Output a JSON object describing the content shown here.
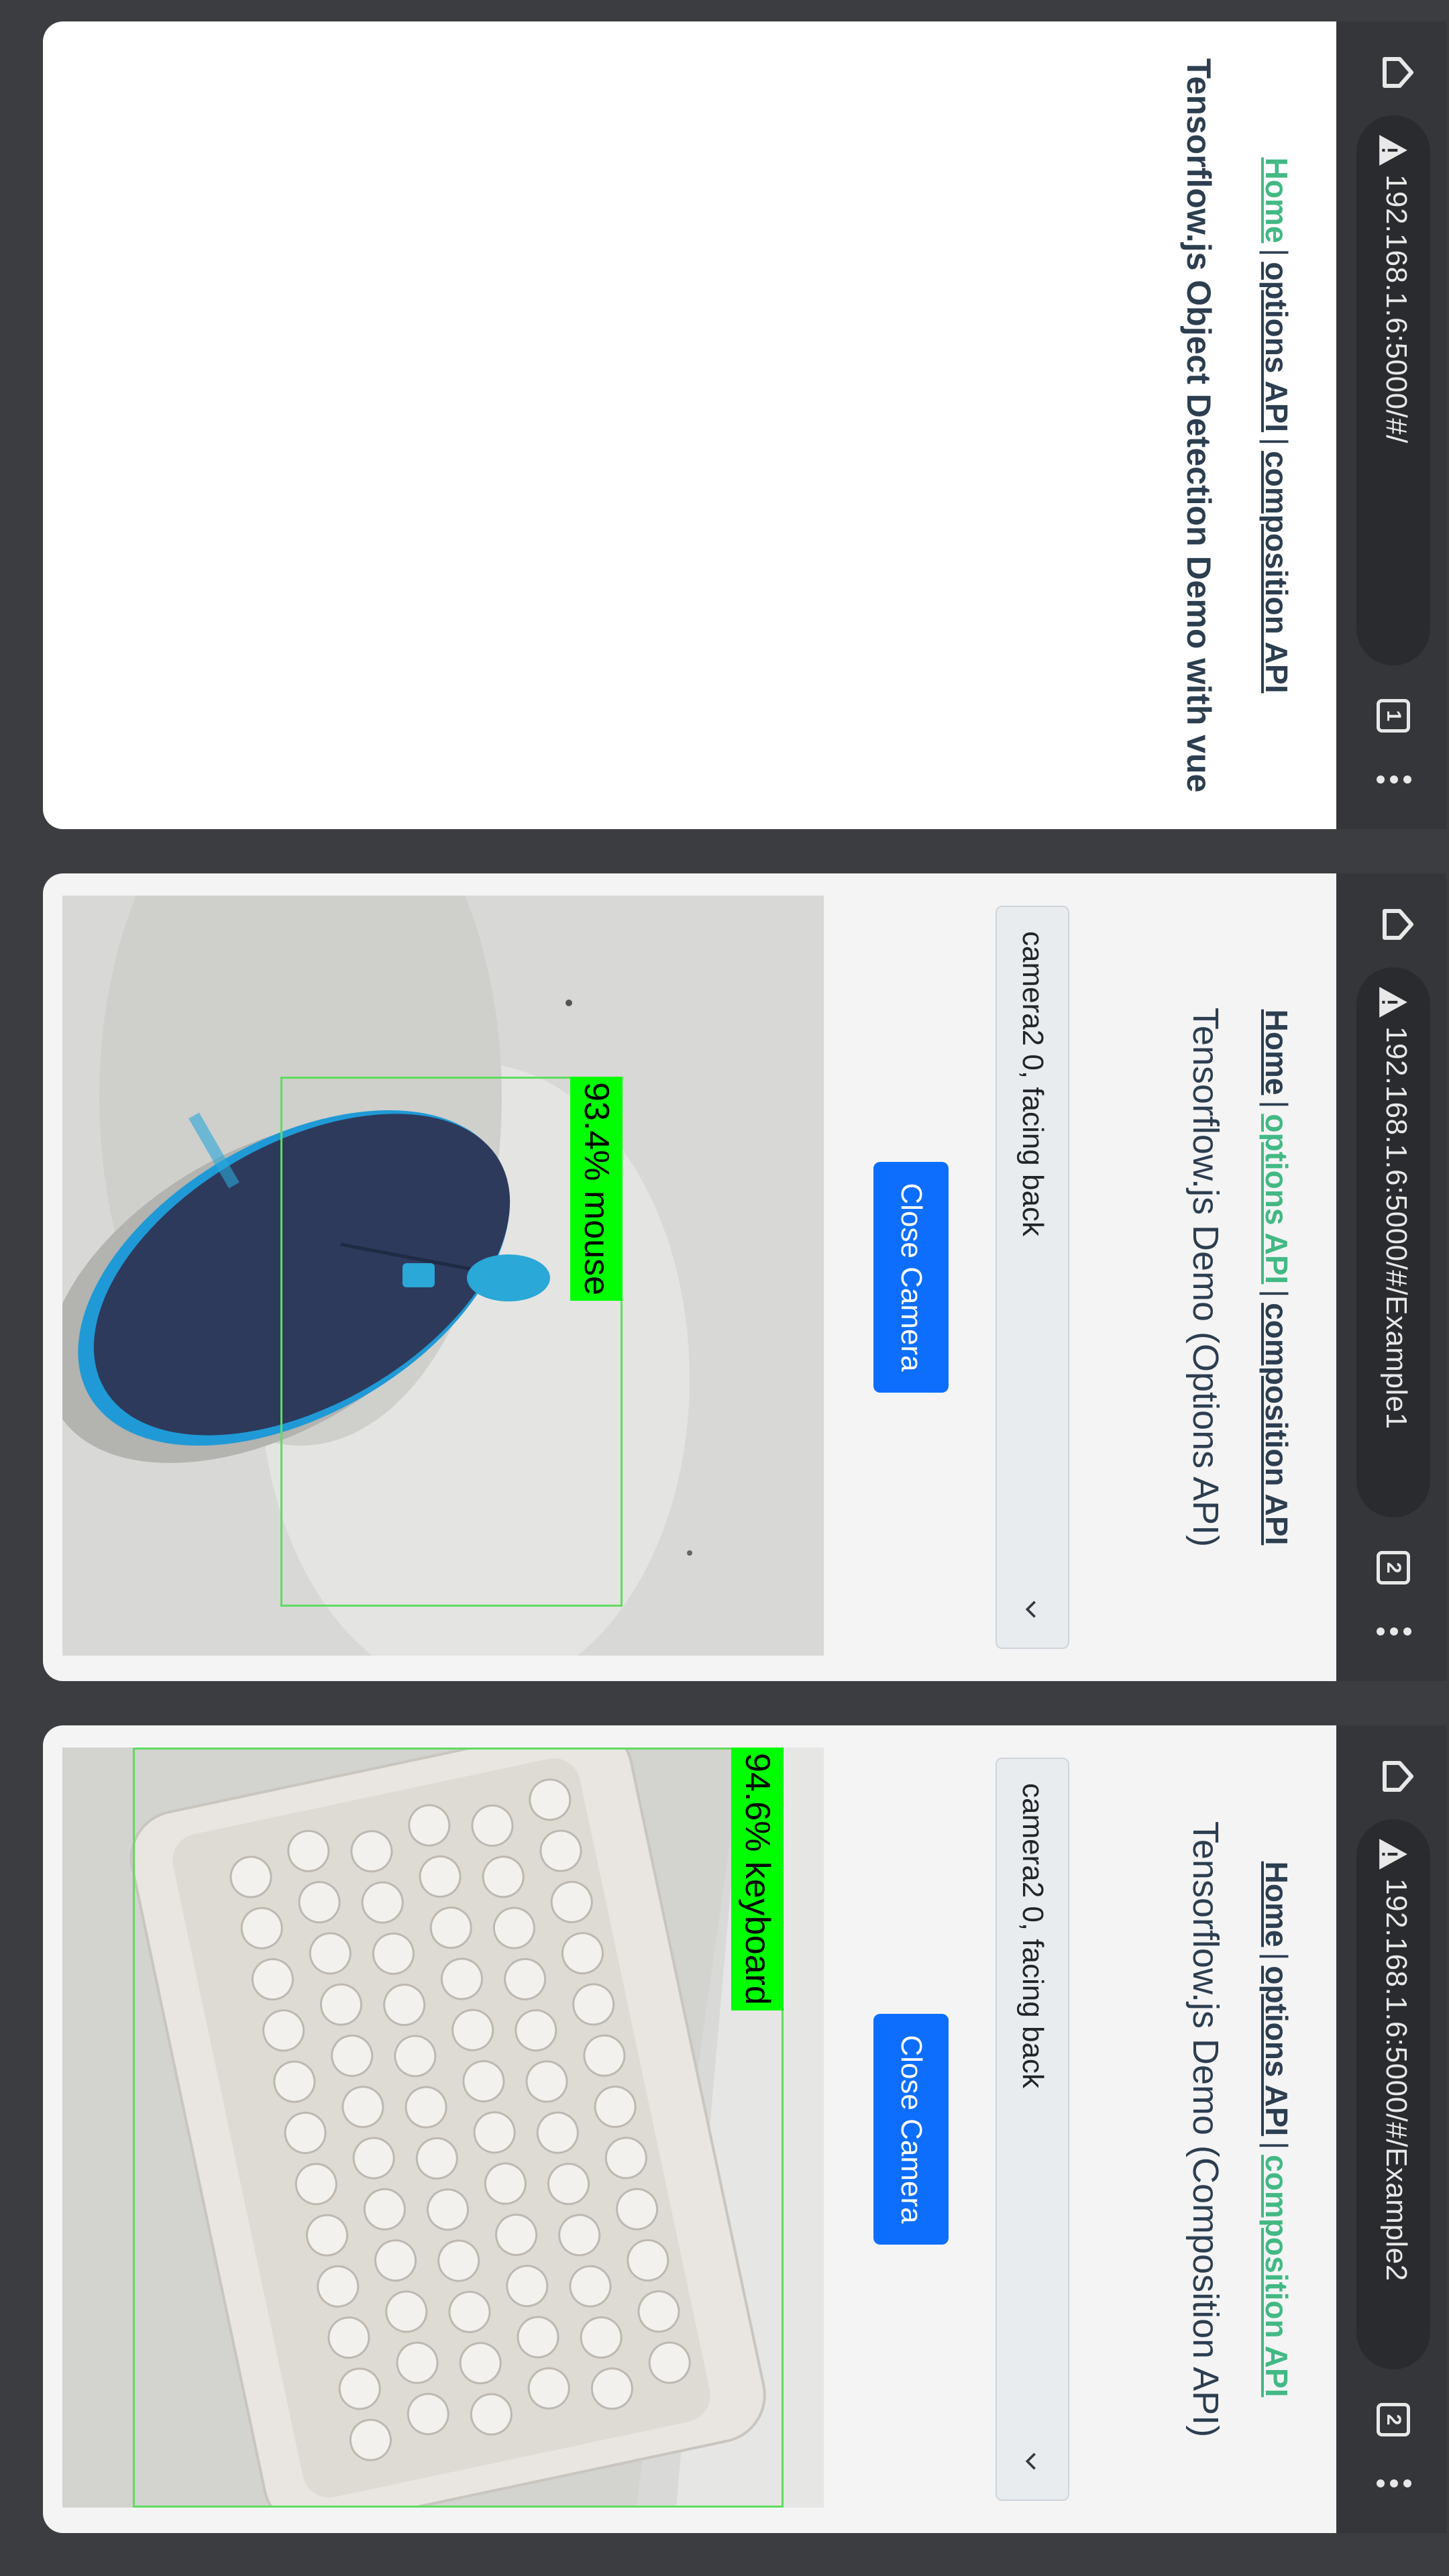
{
  "panels": [
    {
      "browser": {
        "url": "192.168.1.6:5000/#/",
        "tab_count": "1"
      },
      "nav": {
        "home": "Home",
        "options": "options API",
        "composition": "composition API",
        "separator": "|"
      },
      "heading": "Tensorflow.js Object Detection Demo with vue"
    },
    {
      "browser": {
        "url": "192.168.1.6:5000/#/Example1",
        "tab_count": "2"
      },
      "nav": {
        "home": "Home",
        "options": "options API",
        "composition": "composition API",
        "separator": "|"
      },
      "heading": "Tensorflow.js Demo (Options API)",
      "camera_select": "camera2 0, facing back",
      "close_button": "Close Camera",
      "detection": {
        "label": "93.4% mouse",
        "score": 93.4,
        "class": "mouse"
      }
    },
    {
      "browser": {
        "url": "192.168.1.6:5000/#/Example2",
        "tab_count": "2"
      },
      "nav": {
        "home": "Home",
        "options": "options API",
        "composition": "composition API",
        "separator": "|"
      },
      "heading": "Tensorflow.js Demo (Composition API)",
      "camera_select": "camera2 0, facing back",
      "close_button": "Close Camera",
      "detection": {
        "label": "94.6% keyboard",
        "score": 94.6,
        "class": "keyboard"
      }
    }
  ],
  "colors": {
    "active_link": "#42b983",
    "link": "#2c3e50",
    "button": "#0d6efd",
    "detection": "#00ff00"
  },
  "icons": [
    "home-icon",
    "warning-icon",
    "tab-switcher-icon",
    "overflow-menu-icon",
    "chevron-down-icon"
  ]
}
